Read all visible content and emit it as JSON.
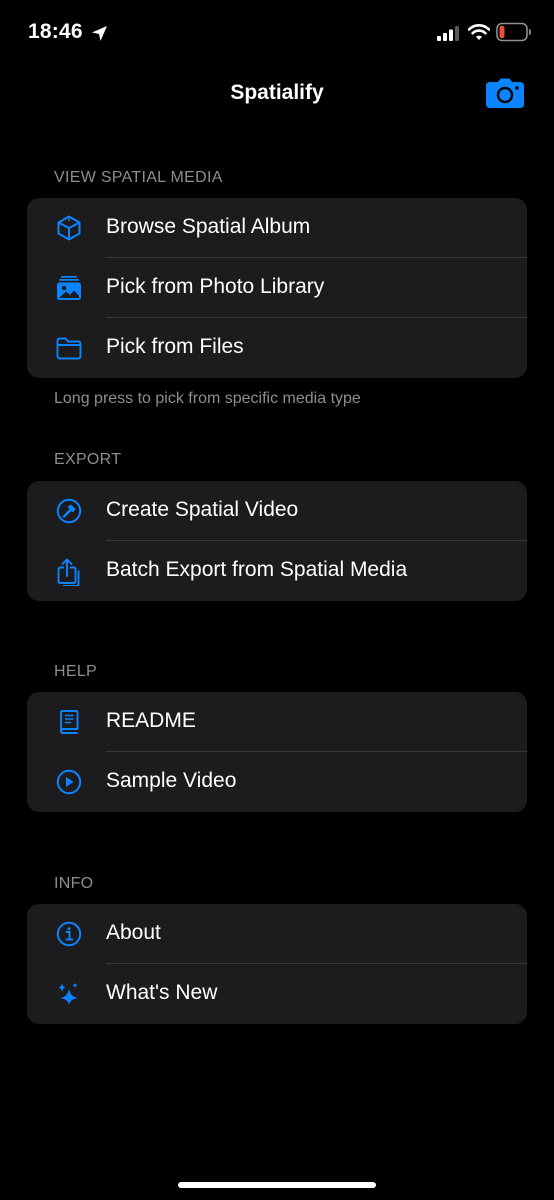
{
  "status_bar": {
    "time": "18:46",
    "battery_color": "#eb4e3d"
  },
  "nav": {
    "title": "Spatialify",
    "camera_icon": "camera-icon"
  },
  "accent_color": "#0a84ff",
  "sections": [
    {
      "header": "VIEW SPATIAL MEDIA",
      "footer": "Long press to pick from specific media type",
      "items": [
        {
          "label": "Browse Spatial Album",
          "icon": "cube-icon"
        },
        {
          "label": "Pick from Photo Library",
          "icon": "photo-stack-icon"
        },
        {
          "label": "Pick from Files",
          "icon": "folder-icon"
        }
      ]
    },
    {
      "header": "EXPORT",
      "items": [
        {
          "label": "Create Spatial Video",
          "icon": "hammer-circle-icon"
        },
        {
          "label": "Batch Export from Spatial Media",
          "icon": "share-stack-icon"
        }
      ]
    },
    {
      "header": "HELP",
      "items": [
        {
          "label": "README",
          "icon": "book-icon"
        },
        {
          "label": "Sample Video",
          "icon": "play-circle-icon"
        }
      ]
    },
    {
      "header": "INFO",
      "items": [
        {
          "label": "About",
          "icon": "info-circle-icon"
        },
        {
          "label": "What's New",
          "icon": "sparkles-icon"
        }
      ]
    }
  ]
}
